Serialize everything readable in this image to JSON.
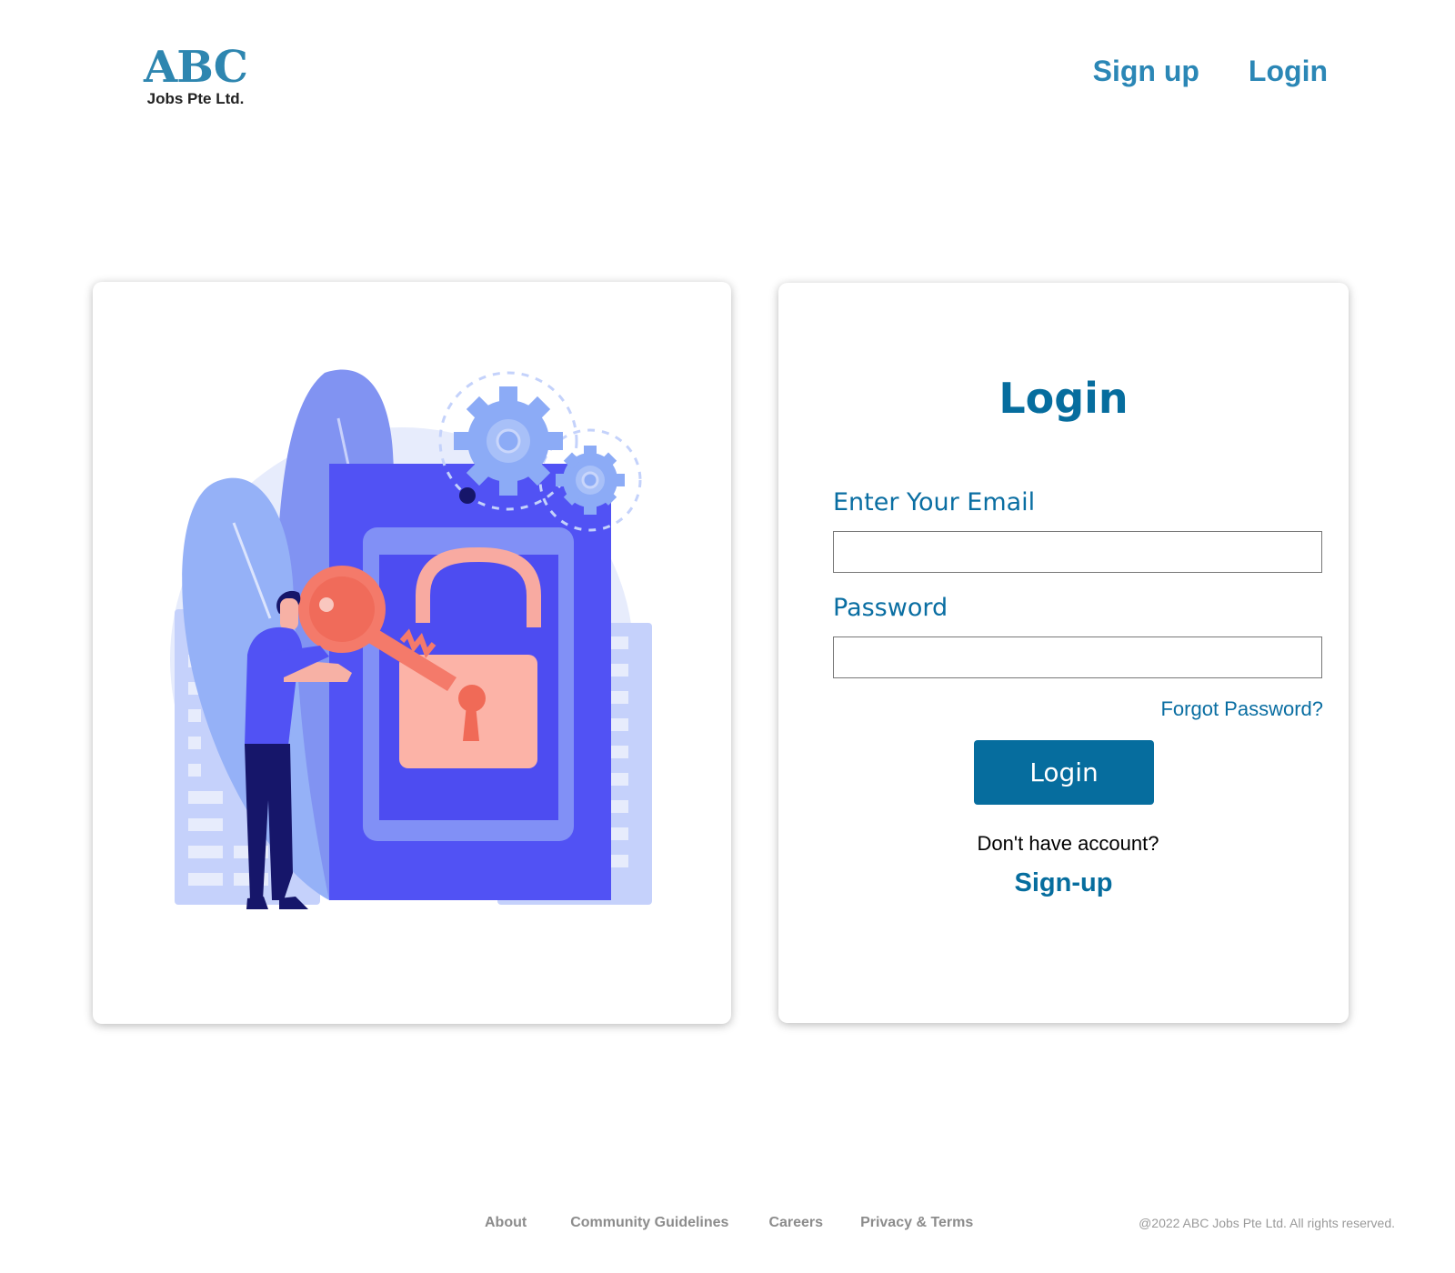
{
  "header": {
    "logo_main": "ABC",
    "logo_sub": "Jobs Pte Ltd.",
    "nav": {
      "signup": "Sign up",
      "login": "Login"
    }
  },
  "illustration": {
    "icon": "unlock-key-illustration"
  },
  "login_form": {
    "title": "Login",
    "email_label": "Enter Your Email",
    "email_value": "",
    "password_label": "Password",
    "password_value": "",
    "forgot_password": "Forgot Password?",
    "submit_label": "Login",
    "no_account_text": "Don't have account?",
    "signup_link": "Sign-up"
  },
  "footer": {
    "links": [
      "About",
      "Community Guidelines",
      "Careers",
      "Privacy & Terms"
    ],
    "copyright": "@2022 ABC Jobs Pte Ltd. All rights reserved."
  },
  "colors": {
    "brand": "#066d9e",
    "nav_link": "#2b87b6",
    "footer_text": "#8c8c8c"
  }
}
